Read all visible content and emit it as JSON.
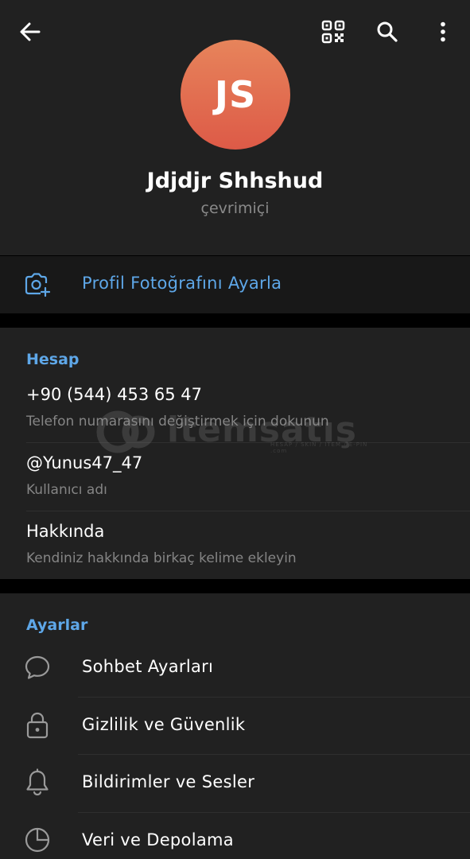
{
  "header": {
    "avatar_initials": "JS",
    "avatar_gradient": [
      "#e7845b",
      "#dd5a47"
    ],
    "name": "Jdjdjr Shhshud",
    "status": "çevrimiçi",
    "icons": [
      "back-arrow-icon",
      "qr-code-icon",
      "search-icon",
      "more-vertical-icon"
    ]
  },
  "photo_action": {
    "icon": "camera-add-icon",
    "label": "Profil Fotoğrafını Ayarla"
  },
  "account": {
    "title": "Hesap",
    "items": [
      {
        "value": "+90 (544) 453 65 47",
        "caption": "Telefon numarasını değiştirmek için dokunun"
      },
      {
        "value": "@Yunus47_47",
        "caption": "Kullanıcı adı"
      },
      {
        "value": "Hakkında",
        "caption": "Kendiniz hakkında birkaç kelime ekleyin"
      }
    ]
  },
  "settings": {
    "title": "Ayarlar",
    "items": [
      {
        "icon": "chat-bubble-icon",
        "label": "Sohbet Ayarları"
      },
      {
        "icon": "lock-icon",
        "label": "Gizlilik ve Güvenlik"
      },
      {
        "icon": "bell-icon",
        "label": "Bildirimler ve Sesler"
      },
      {
        "icon": "pie-chart-icon",
        "label": "Veri ve Depolama"
      }
    ]
  },
  "watermark": {
    "text": "itemsatış",
    "tagline": "HESAP / SKIN / ITEM / E-PIN .com"
  },
  "colors": {
    "background": "#212121",
    "accent": "#5ea7e8",
    "secondary_text": "#858585"
  }
}
